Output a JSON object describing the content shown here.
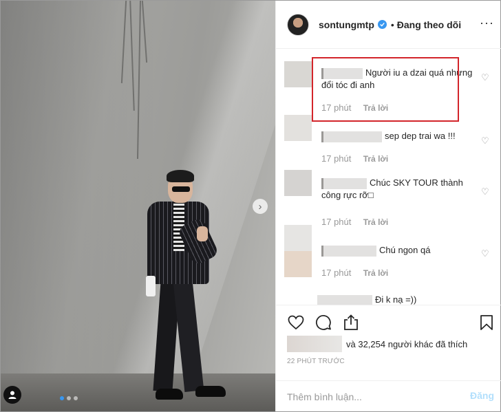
{
  "post": {
    "username": "sontungmtp",
    "verified_icon": "check-icon",
    "separator": "•",
    "follow_status": "Đang theo dõi",
    "more_icon": "more-icon"
  },
  "comments": [
    {
      "text": "Người iu a dzai quá nhưng đổi tóc đi anh",
      "time": "17 phút",
      "reply": "Trả lời",
      "highlighted": true
    },
    {
      "text": "sep dep trai wa !!!",
      "time": "17 phút",
      "reply": "Trả lời"
    },
    {
      "text": "Chúc SKY TOUR thành công rực rỡ□",
      "time": "17 phút",
      "reply": "Trả lời"
    },
    {
      "text": "Chú ngon qá",
      "time": "17 phút",
      "reply": "Trả lời"
    },
    {
      "text": "Đi k nạ =))",
      "time": "",
      "reply": ""
    }
  ],
  "likes": {
    "text": "và 32,254 người khác đã thích"
  },
  "time_ago": "22 PHÚT TRƯỚC",
  "comment_input": {
    "placeholder": "Thêm bình luận...",
    "value": ""
  },
  "post_button": "Đăng",
  "carousel": {
    "current": 1,
    "total": 3
  },
  "colors": {
    "highlight_border": "#d3242a",
    "verified": "#3897f0",
    "post_button": "#b2dffc"
  }
}
